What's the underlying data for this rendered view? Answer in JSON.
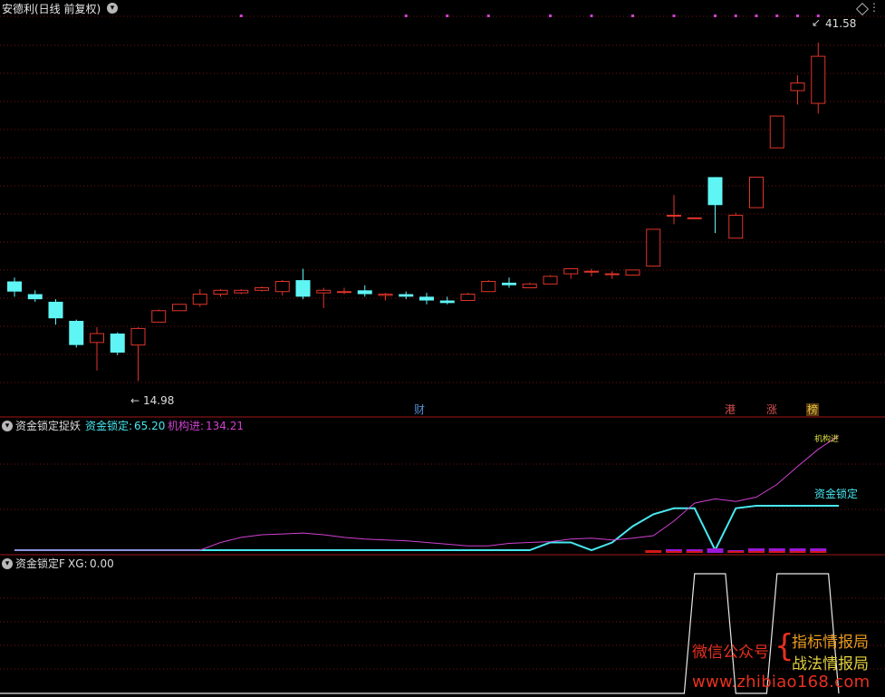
{
  "main_pane": {
    "title": "安德利(日线 前复权)",
    "high_label": "41.58",
    "low_label": "14.98",
    "event_tags": [
      {
        "text": "财",
        "color": "#4f8fd8"
      },
      {
        "text": "港",
        "color": "#d85050"
      },
      {
        "text": "涨",
        "color": "#d85050"
      },
      {
        "text": "榜",
        "color": "#e0c040"
      }
    ],
    "colors": {
      "up": "#e0342a",
      "down": "#5ff5f5",
      "grid": "#7a1010",
      "pane_border": "#a01818",
      "event_dot": "#d040d0"
    }
  },
  "indicator_pane": {
    "title": "资金锁定捉妖",
    "value1_label": "资金锁定:",
    "value1": "65.20",
    "value2_label": "机构进:",
    "value2": "134.21",
    "line_label_cyan": "资金锁定",
    "line_label_magenta": "机构进",
    "colors": {
      "cyan": "#48e8f0",
      "magenta": "#d040d0"
    }
  },
  "signal_pane": {
    "title": "资金锁定F",
    "xg_label": "XG:",
    "xg_value": "0.00"
  },
  "watermark": {
    "line1": "微信公众号",
    "line2a": "指标情报局",
    "line2b": "战法情报局",
    "url": "www.zhibiao168.com"
  },
  "chart_data": {
    "type": "candlestick",
    "candles": [
      {
        "o": 22.8,
        "h": 23.1,
        "l": 21.6,
        "c": 22.0
      },
      {
        "o": 21.8,
        "h": 22.1,
        "l": 21.2,
        "c": 21.4
      },
      {
        "o": 21.2,
        "h": 21.4,
        "l": 19.4,
        "c": 19.9
      },
      {
        "o": 19.7,
        "h": 19.8,
        "l": 17.6,
        "c": 17.8
      },
      {
        "o": 18.0,
        "h": 19.2,
        "l": 15.8,
        "c": 18.7
      },
      {
        "o": 18.7,
        "h": 18.8,
        "l": 17.0,
        "c": 17.2
      },
      {
        "o": 17.8,
        "h": 19.2,
        "l": 14.98,
        "c": 19.1
      },
      {
        "o": 19.6,
        "h": 20.6,
        "l": 19.6,
        "c": 20.5
      },
      {
        "o": 20.5,
        "h": 21.0,
        "l": 20.5,
        "c": 21.0
      },
      {
        "o": 21.0,
        "h": 22.2,
        "l": 20.8,
        "c": 21.8
      },
      {
        "o": 21.8,
        "h": 22.2,
        "l": 21.6,
        "c": 22.1
      },
      {
        "o": 21.9,
        "h": 22.2,
        "l": 21.8,
        "c": 22.1
      },
      {
        "o": 22.1,
        "h": 22.4,
        "l": 22.0,
        "c": 22.3
      },
      {
        "o": 22.0,
        "h": 22.9,
        "l": 21.7,
        "c": 22.8
      },
      {
        "o": 22.9,
        "h": 23.8,
        "l": 21.4,
        "c": 21.6
      },
      {
        "o": 21.9,
        "h": 22.3,
        "l": 20.7,
        "c": 22.1
      },
      {
        "o": 22.0,
        "h": 22.3,
        "l": 21.8,
        "c": 22.0
      },
      {
        "o": 22.1,
        "h": 22.5,
        "l": 21.6,
        "c": 21.8
      },
      {
        "o": 21.7,
        "h": 21.9,
        "l": 21.3,
        "c": 21.8
      },
      {
        "o": 21.8,
        "h": 22.0,
        "l": 21.4,
        "c": 21.6
      },
      {
        "o": 21.6,
        "h": 21.9,
        "l": 21.0,
        "c": 21.3
      },
      {
        "o": 21.3,
        "h": 21.6,
        "l": 21.0,
        "c": 21.1
      },
      {
        "o": 21.3,
        "h": 21.9,
        "l": 21.3,
        "c": 21.8
      },
      {
        "o": 22.0,
        "h": 22.9,
        "l": 22.0,
        "c": 22.8
      },
      {
        "o": 22.7,
        "h": 23.1,
        "l": 22.3,
        "c": 22.5
      },
      {
        "o": 22.3,
        "h": 22.7,
        "l": 22.3,
        "c": 22.6
      },
      {
        "o": 22.6,
        "h": 23.3,
        "l": 22.6,
        "c": 23.2
      },
      {
        "o": 23.4,
        "h": 23.8,
        "l": 23.0,
        "c": 23.8
      },
      {
        "o": 23.6,
        "h": 23.8,
        "l": 23.2,
        "c": 23.6
      },
      {
        "o": 23.4,
        "h": 23.6,
        "l": 23.0,
        "c": 23.4
      },
      {
        "o": 23.3,
        "h": 23.7,
        "l": 23.3,
        "c": 23.7
      },
      {
        "o": 24.0,
        "h": 26.9,
        "l": 24.0,
        "c": 26.9
      },
      {
        "o": 28.0,
        "h": 29.6,
        "l": 27.3,
        "c": 28.0
      },
      {
        "o": 27.8,
        "h": 27.8,
        "l": 27.8,
        "c": 27.8
      },
      {
        "o": 31.0,
        "h": 31.0,
        "l": 26.6,
        "c": 28.8
      },
      {
        "o": 26.2,
        "h": 28.2,
        "l": 26.2,
        "c": 28.0
      },
      {
        "o": 28.6,
        "h": 31.0,
        "l": 28.6,
        "c": 31.0
      },
      {
        "o": 33.3,
        "h": 35.8,
        "l": 33.3,
        "c": 35.8
      },
      {
        "o": 37.8,
        "h": 39.0,
        "l": 36.7,
        "c": 38.4
      },
      {
        "o": 36.8,
        "h": 41.58,
        "l": 36.0,
        "c": 40.5
      }
    ],
    "event_dots_at": [
      11,
      19,
      21,
      23,
      26,
      28,
      30,
      32,
      34,
      35,
      36,
      37,
      38,
      39
    ],
    "event_tags_at": [
      20,
      34,
      37,
      39
    ],
    "indicator_series": [
      {
        "name": "资金锁定",
        "values": [
          0,
          0,
          0,
          0,
          0,
          0,
          0,
          0,
          0,
          0,
          0,
          0,
          0,
          0,
          0,
          0,
          0,
          0,
          0,
          0,
          0,
          0,
          0,
          0,
          0,
          0,
          9,
          9,
          0,
          9,
          28,
          42,
          49,
          49,
          0,
          49,
          52,
          52,
          52,
          52,
          52
        ]
      },
      {
        "name": "机构进",
        "values": [
          0,
          0,
          0,
          0,
          0,
          0,
          0,
          0,
          0,
          0,
          9,
          15,
          18,
          19,
          20,
          18,
          15,
          13,
          12,
          11,
          9,
          7,
          5,
          5,
          8,
          9,
          10,
          13,
          14,
          12,
          14,
          17,
          34,
          55,
          60,
          57,
          62,
          77,
          98,
          118,
          134.21
        ]
      }
    ],
    "bars_values": [
      2,
      3,
      3,
      4,
      2,
      4,
      4,
      4,
      4
    ],
    "bars_at": [
      31,
      32,
      33,
      34,
      35,
      36,
      37,
      38,
      39
    ],
    "xg_series": [
      0,
      0,
      0,
      0,
      0,
      0,
      0,
      0,
      0,
      0,
      0,
      0,
      0,
      0,
      0,
      0,
      0,
      0,
      0,
      0,
      0,
      0,
      0,
      0,
      0,
      0,
      0,
      0,
      0,
      0,
      0,
      0,
      0,
      1,
      1,
      0,
      0,
      1,
      1,
      1,
      0
    ],
    "ylim_main": [
      13.5,
      43.5
    ]
  }
}
